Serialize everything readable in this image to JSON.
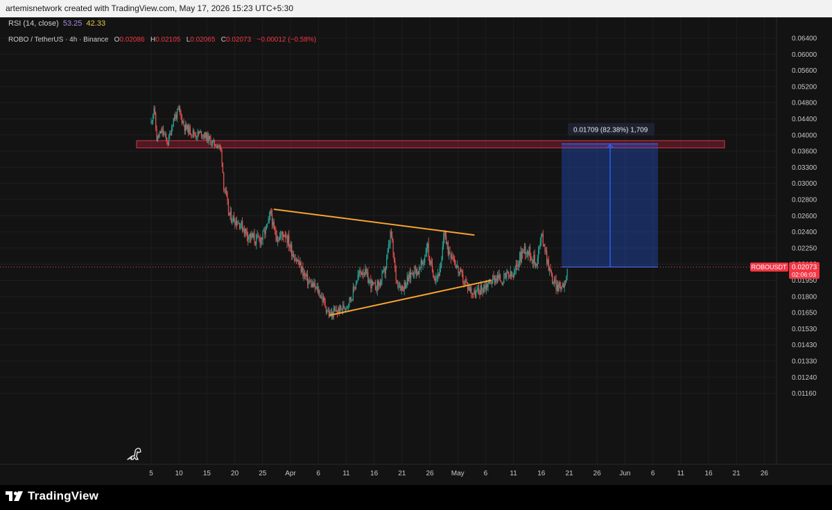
{
  "header": {
    "attribution": "artemisnetwork created with TradingView.com, May 17, 2026 15:23 UTC+5:30"
  },
  "indicator": {
    "label": "RSI (14, close)",
    "v1": "53.25",
    "v2": "42.33"
  },
  "legend": {
    "symbol": "ROBO / TetherUS · 4h · Binance",
    "o_label": "O",
    "o": "0.02086",
    "h_label": "H",
    "h": "0.02105",
    "l_label": "L",
    "l": "0.02065",
    "c_label": "C",
    "c": "0.02073",
    "change": "−0.00012 (−0.58%)"
  },
  "price_badge": {
    "symbol": "ROBOUSDT",
    "price": "0.02073",
    "countdown": "02:06:03"
  },
  "measure_label": "0.01709 (82.38%) 1,709",
  "brand": {
    "name": "TradingView"
  },
  "colors": {
    "bg": "#131313",
    "up": "#26a69a",
    "down": "#ef5350",
    "trend": "#f7a531",
    "zone": "#b3263a",
    "measure": "#2962ff"
  },
  "chart_data": {
    "type": "candlestick",
    "symbol": "ROBO / TetherUS",
    "interval": "4h",
    "y_ticks": [
      "0.06400",
      "0.06000",
      "0.05600",
      "0.05200",
      "0.04800",
      "0.04400",
      "0.04000",
      "0.03600",
      "0.03300",
      "0.03000",
      "0.02800",
      "0.02600",
      "0.02400",
      "0.02250",
      "0.02100",
      "0.01950",
      "0.01800",
      "0.01650",
      "0.01530",
      "0.01430",
      "0.01330",
      "0.01240",
      "0.01160"
    ],
    "x_ticks": [
      "5",
      "10",
      "15",
      "20",
      "25",
      "Apr",
      "6",
      "11",
      "16",
      "21",
      "26",
      "May",
      "6",
      "11",
      "16",
      "21",
      "26",
      "Jun",
      "6",
      "11",
      "16",
      "21",
      "26"
    ],
    "price_path": [
      [
        5,
        0.043
      ],
      [
        5.5,
        0.047
      ],
      [
        6,
        0.039
      ],
      [
        7,
        0.041
      ],
      [
        8,
        0.038
      ],
      [
        9,
        0.044
      ],
      [
        10,
        0.046
      ],
      [
        11,
        0.042
      ],
      [
        12,
        0.041
      ],
      [
        13,
        0.04
      ],
      [
        14,
        0.0405
      ],
      [
        15,
        0.0395
      ],
      [
        16,
        0.038
      ],
      [
        17,
        0.0375
      ],
      [
        17.6,
        0.036
      ],
      [
        18,
        0.03
      ],
      [
        18.5,
        0.028
      ],
      [
        19,
        0.026
      ],
      [
        20,
        0.0255
      ],
      [
        21,
        0.025
      ],
      [
        22,
        0.024
      ],
      [
        23,
        0.0235
      ],
      [
        24,
        0.0232
      ],
      [
        25,
        0.0235
      ],
      [
        26,
        0.025
      ],
      [
        26.5,
        0.0265
      ],
      [
        27,
        0.024
      ],
      [
        28,
        0.0235
      ],
      [
        29,
        0.024
      ],
      [
        30,
        0.0225
      ],
      [
        31,
        0.0215
      ],
      [
        32,
        0.0205
      ],
      [
        33,
        0.0195
      ],
      [
        34,
        0.019
      ],
      [
        35,
        0.0185
      ],
      [
        36,
        0.0175
      ],
      [
        36.5,
        0.0168
      ],
      [
        37,
        0.0163
      ],
      [
        38,
        0.0166
      ],
      [
        39,
        0.0168
      ],
      [
        40,
        0.0172
      ],
      [
        41,
        0.018
      ],
      [
        42,
        0.0198
      ],
      [
        43,
        0.0205
      ],
      [
        44,
        0.0195
      ],
      [
        45,
        0.0188
      ],
      [
        46,
        0.0192
      ],
      [
        47,
        0.0205
      ],
      [
        47.6,
        0.0225
      ],
      [
        48,
        0.024
      ],
      [
        48.5,
        0.0215
      ],
      [
        49,
        0.0195
      ],
      [
        50,
        0.0188
      ],
      [
        51,
        0.0195
      ],
      [
        52,
        0.0205
      ],
      [
        53,
        0.0203
      ],
      [
        54,
        0.0215
      ],
      [
        54.5,
        0.023
      ],
      [
        55,
        0.021
      ],
      [
        56,
        0.0198
      ],
      [
        57,
        0.0205
      ],
      [
        57.6,
        0.0245
      ],
      [
        58,
        0.0225
      ],
      [
        59,
        0.022
      ],
      [
        60,
        0.0205
      ],
      [
        61,
        0.0195
      ],
      [
        62,
        0.0188
      ],
      [
        63,
        0.0182
      ],
      [
        64,
        0.0186
      ],
      [
        65,
        0.019
      ],
      [
        66,
        0.0195
      ],
      [
        67,
        0.0198
      ],
      [
        68,
        0.0195
      ],
      [
        69,
        0.02
      ],
      [
        70,
        0.0198
      ],
      [
        71,
        0.0215
      ],
      [
        72,
        0.0225
      ],
      [
        73,
        0.022
      ],
      [
        74,
        0.021
      ],
      [
        75,
        0.0235
      ],
      [
        75.5,
        0.023
      ],
      [
        76,
        0.0215
      ],
      [
        77,
        0.0195
      ],
      [
        78,
        0.0188
      ],
      [
        79,
        0.0192
      ],
      [
        79.8,
        0.02073
      ]
    ],
    "annotations": {
      "supply_zone": [
        0.0368,
        0.0386
      ],
      "upper_trendline": [
        [
          27,
          0.0268
        ],
        [
          63,
          0.0237
        ]
      ],
      "lower_trendline": [
        [
          37,
          0.0163
        ],
        [
          66,
          0.0195
        ]
      ],
      "measure": {
        "from": 0.02073,
        "to": 0.0378,
        "label": "0.01709 (82.38%) 1,709"
      }
    }
  }
}
